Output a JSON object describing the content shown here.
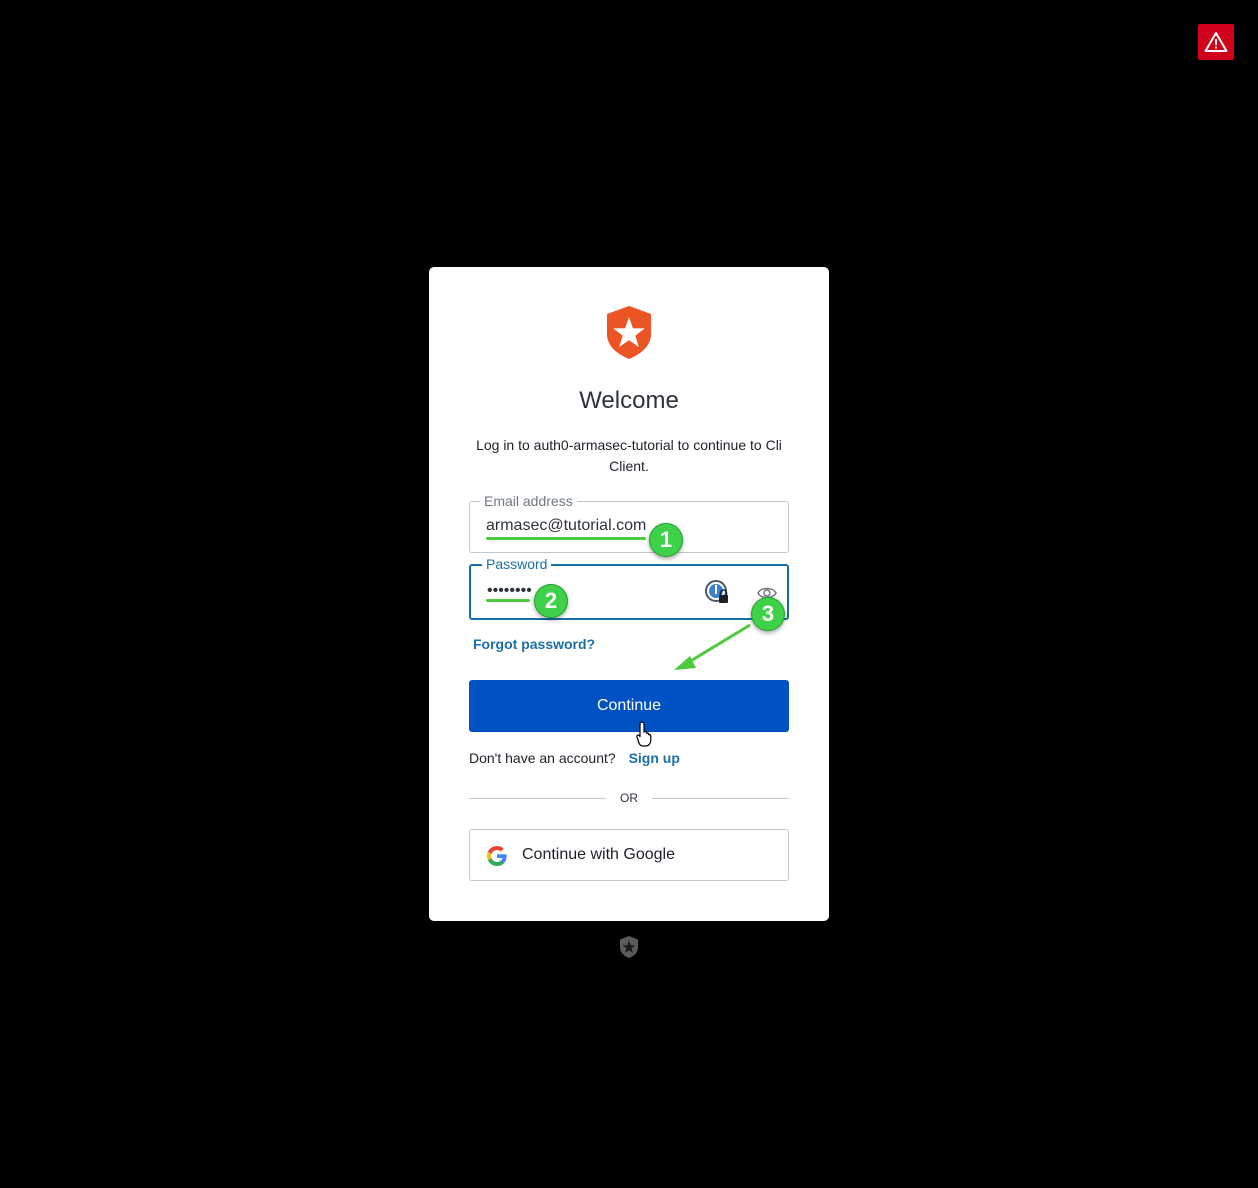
{
  "header": {
    "warning_icon": "warning-triangle-icon",
    "warning_color": "#d0021b"
  },
  "login": {
    "logo_icon": "auth0-shield-star-logo",
    "logo_color": "#eb5424",
    "title": "Welcome",
    "subtitle": "Log in to auth0-armasec-tutorial to continue to Cli Client.",
    "email_label": "Email address",
    "email_value": "armasec@tutorial.com",
    "password_label": "Password",
    "password_value": "••••••••",
    "forgot_label": "Forgot password?",
    "continue_label": "Continue",
    "no_account_text": "Don't have an account?",
    "signup_label": "Sign up",
    "or_text": "OR",
    "google_label": "Continue with Google",
    "accent_color": "#0052c3",
    "link_color": "#1a6fa8"
  },
  "annotations": {
    "badges": [
      "1",
      "2",
      "3"
    ],
    "color": "#3fd14a"
  },
  "footer": {
    "logo_icon": "auth0-footer-logo"
  }
}
